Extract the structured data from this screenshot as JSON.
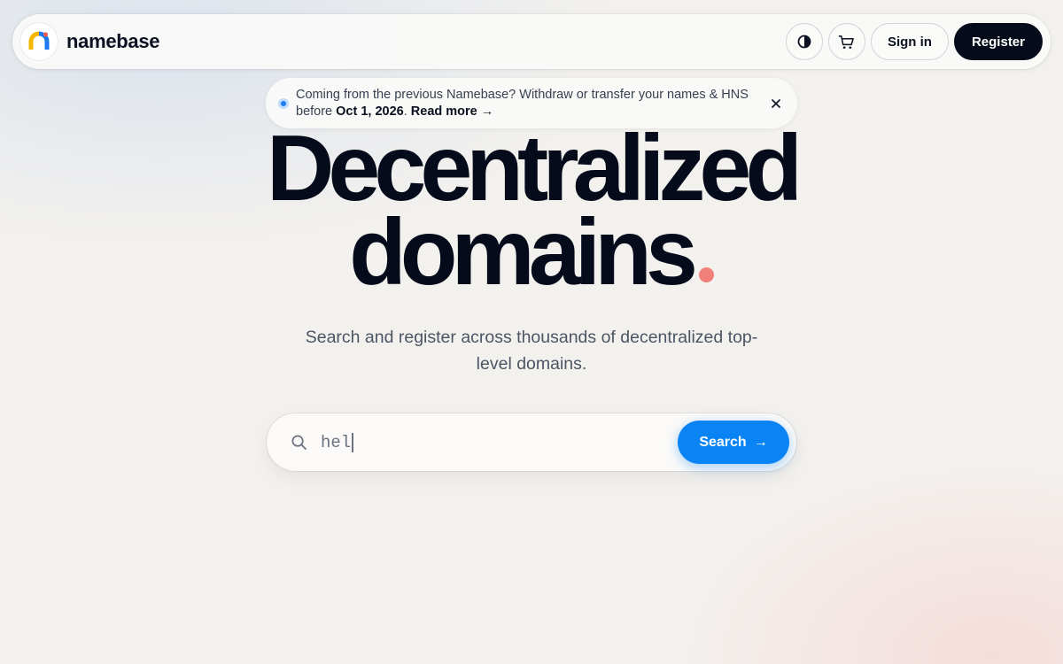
{
  "header": {
    "brand_name": "namebase",
    "theme_icon": "half-circle-contrast-icon",
    "cart_icon": "shopping-cart-icon",
    "signin_label": "Sign in",
    "register_label": "Register"
  },
  "notice": {
    "text_prefix": "Coming from the previous Namebase? Withdraw or transfer your names & HNS before ",
    "date": "Oct 1, 2026",
    "text_suffix": ". ",
    "link_label": "Read more →",
    "close_icon": "close-icon"
  },
  "hero": {
    "title_line1": "Decentralized",
    "title_line2": "domains",
    "subtitle": "Search and register across thousands of decentralized top-level domains."
  },
  "search": {
    "value": "hel",
    "button_label": "Search",
    "button_arrow": "→"
  },
  "colors": {
    "accent_blue": "#0a84f5",
    "dark": "#050b1a",
    "dot_coral": "#f2807a"
  }
}
